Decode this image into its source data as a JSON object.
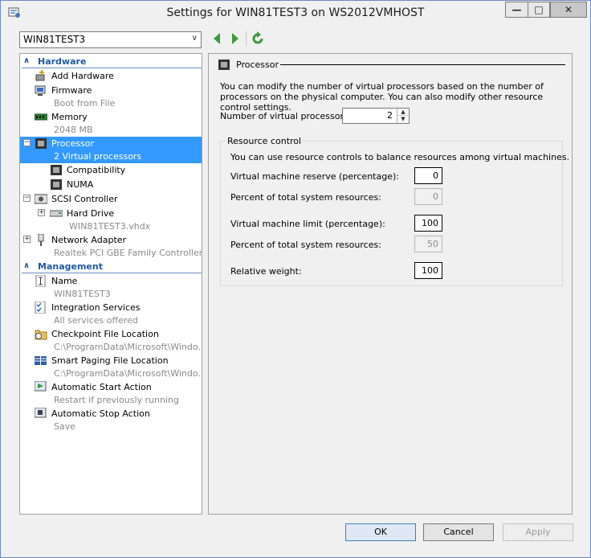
{
  "window": {
    "title": "Settings for WIN81TEST3 on WS2012VMHOST",
    "min_glyph": "—",
    "max_glyph": "□",
    "close_glyph": "✕"
  },
  "vm_selector": {
    "value": "WIN81TEST3",
    "arrow": "∨"
  },
  "tree": {
    "hardware_label": "Hardware",
    "management_label": "Management",
    "section_chevron": "∧",
    "hardware": [
      {
        "label": "Add Hardware",
        "sub": ""
      },
      {
        "label": "Firmware",
        "sub": "Boot from File"
      },
      {
        "label": "Memory",
        "sub": "2048 MB"
      },
      {
        "label": "Processor",
        "sub": "2 Virtual processors",
        "expander": "−"
      },
      {
        "label": "Compatibility",
        "sub": ""
      },
      {
        "label": "NUMA",
        "sub": ""
      },
      {
        "label": "SCSI Controller",
        "sub": "",
        "expander": "−"
      },
      {
        "label": "Hard Drive",
        "sub": "WIN81TEST3.vhdx",
        "expander": "+"
      },
      {
        "label": "Network Adapter",
        "sub": "Realtek PCI GBE Family Controller ...",
        "expander": "+"
      }
    ],
    "management": [
      {
        "label": "Name",
        "sub": "WIN81TEST3"
      },
      {
        "label": "Integration Services",
        "sub": "All services offered"
      },
      {
        "label": "Checkpoint File Location",
        "sub": "C:\\ProgramData\\Microsoft\\Windo..."
      },
      {
        "label": "Smart Paging File Location",
        "sub": "C:\\ProgramData\\Microsoft\\Windo..."
      },
      {
        "label": "Automatic Start Action",
        "sub": "Restart if previously running"
      },
      {
        "label": "Automatic Stop Action",
        "sub": "Save"
      }
    ]
  },
  "processor": {
    "heading": "Processor",
    "description": "You can modify the number of virtual processors based on the number of processors on the physical computer. You can also modify other resource control settings.",
    "num_label": "Number of virtual processors:",
    "num_value": "2",
    "spin_up": "▲",
    "spin_down": "▼",
    "group_title": "Resource control",
    "group_desc": "You can use resource controls to balance resources among virtual machines.",
    "reserve_label": "Virtual machine reserve (percentage):",
    "reserve_value": "0",
    "reserve_pct_label": "Percent of total system resources:",
    "reserve_pct_value": "0",
    "limit_label": "Virtual machine limit (percentage):",
    "limit_value": "100",
    "limit_pct_label": "Percent of total system resources:",
    "limit_pct_value": "50",
    "weight_label": "Relative weight:",
    "weight_value": "100"
  },
  "buttons": {
    "ok": "OK",
    "cancel": "Cancel",
    "apply": "Apply"
  },
  "colors": {
    "accent": "#1f5aa6",
    "selection": "#3399ff",
    "nav_green": "#3a9b3a"
  }
}
